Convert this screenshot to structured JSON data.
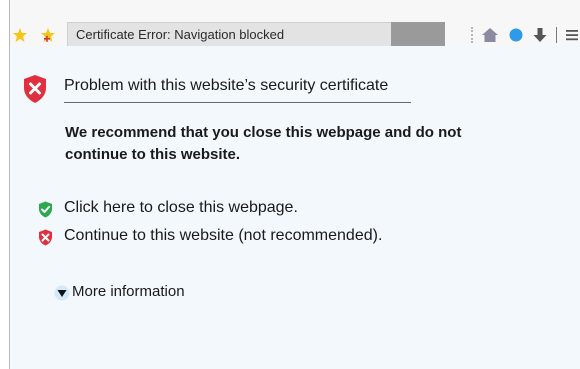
{
  "tab": {
    "title": "Certificate Error: Navigation blocked"
  },
  "toolbar": {
    "icons": [
      "home-icon",
      "status-dot-icon",
      "download-icon",
      "menu-icon"
    ]
  },
  "page": {
    "heading": "Problem with this website’s security certificate",
    "recommendation": "We recommend that you close this webpage and do not continue to this website.",
    "options": {
      "close": "Click here to close this webpage.",
      "continue": "Continue to this website (not recommended)."
    },
    "more_info": "More information"
  },
  "colors": {
    "danger": "#e0303f",
    "safe": "#2ea84e",
    "accent": "#2f9be8",
    "icon_gray": "#8a8aa0"
  }
}
